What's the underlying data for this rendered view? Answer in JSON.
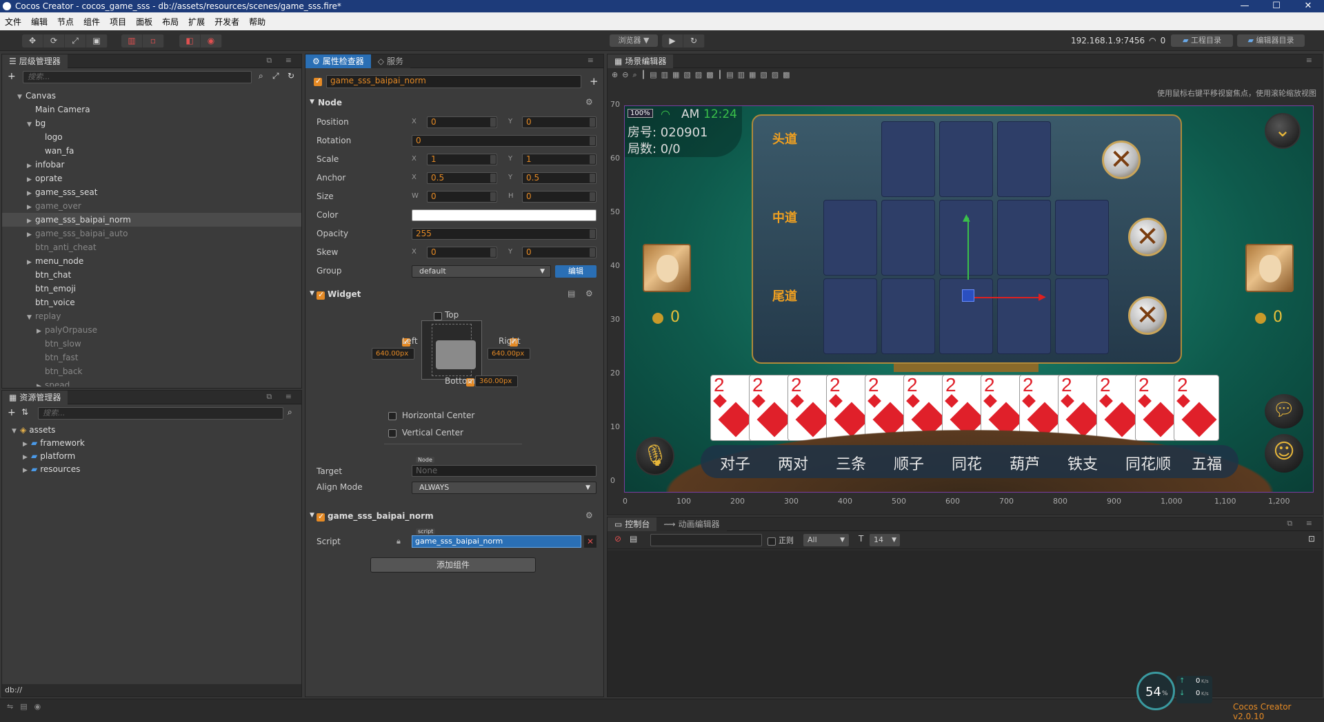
{
  "window": {
    "title": "Cocos Creator - cocos_game_sss - db://assets/resources/scenes/game_sss.fire*"
  },
  "menu": [
    "文件",
    "编辑",
    "节点",
    "组件",
    "项目",
    "面板",
    "布局",
    "扩展",
    "开发者",
    "帮助"
  ],
  "toolbar": {
    "preview_label": "浏览器 ▼",
    "ip": "192.168.1.9:7456",
    "conn_count": "0",
    "project_dir": "工程目录",
    "editor_dir": "编辑器目录"
  },
  "hierarchy": {
    "title": "层级管理器",
    "search_placeholder": "搜索...",
    "nodes": [
      {
        "label": "Canvas",
        "depth": 0,
        "arrow": "▼",
        "dim": false
      },
      {
        "label": "Main Camera",
        "depth": 1,
        "arrow": "",
        "dim": false
      },
      {
        "label": "bg",
        "depth": 1,
        "arrow": "▼",
        "dim": false
      },
      {
        "label": "logo",
        "depth": 2,
        "arrow": "",
        "dim": false
      },
      {
        "label": "wan_fa",
        "depth": 2,
        "arrow": "",
        "dim": false
      },
      {
        "label": "infobar",
        "depth": 1,
        "arrow": "▶",
        "dim": false
      },
      {
        "label": "oprate",
        "depth": 1,
        "arrow": "▶",
        "dim": false
      },
      {
        "label": "game_sss_seat",
        "depth": 1,
        "arrow": "▶",
        "dim": false
      },
      {
        "label": "game_over",
        "depth": 1,
        "arrow": "▶",
        "dim": true
      },
      {
        "label": "game_sss_baipai_norm",
        "depth": 1,
        "arrow": "▶",
        "dim": false,
        "selected": true
      },
      {
        "label": "game_sss_baipai_auto",
        "depth": 1,
        "arrow": "▶",
        "dim": true
      },
      {
        "label": "btn_anti_cheat",
        "depth": 1,
        "arrow": "",
        "dim": true
      },
      {
        "label": "menu_node",
        "depth": 1,
        "arrow": "▶",
        "dim": false
      },
      {
        "label": "btn_chat",
        "depth": 1,
        "arrow": "",
        "dim": false
      },
      {
        "label": "btn_emoji",
        "depth": 1,
        "arrow": "",
        "dim": false
      },
      {
        "label": "btn_voice",
        "depth": 1,
        "arrow": "",
        "dim": false
      },
      {
        "label": "replay",
        "depth": 1,
        "arrow": "▼",
        "dim": true
      },
      {
        "label": "palyOrpause",
        "depth": 2,
        "arrow": "▶",
        "dim": true
      },
      {
        "label": "btn_slow",
        "depth": 2,
        "arrow": "",
        "dim": true
      },
      {
        "label": "btn_fast",
        "depth": 2,
        "arrow": "",
        "dim": true
      },
      {
        "label": "btn_back",
        "depth": 2,
        "arrow": "",
        "dim": true
      },
      {
        "label": "spead",
        "depth": 2,
        "arrow": "▶",
        "dim": true
      }
    ]
  },
  "assets": {
    "title": "资源管理器",
    "search_placeholder": "搜索...",
    "items": [
      {
        "label": "assets",
        "depth": 0,
        "arrow": "▼"
      },
      {
        "label": "framework",
        "depth": 1,
        "arrow": "▶"
      },
      {
        "label": "platform",
        "depth": 1,
        "arrow": "▶"
      },
      {
        "label": "resources",
        "depth": 1,
        "arrow": "▶"
      }
    ],
    "status": "db://"
  },
  "inspector": {
    "tab_active": "属性检查器",
    "tab_inactive": "服务",
    "node_name": "game_sss_baipai_norm",
    "node_section": "Node",
    "props": {
      "position": {
        "label": "Position",
        "x": "0",
        "y": "0"
      },
      "rotation": {
        "label": "Rotation",
        "v": "0"
      },
      "scale": {
        "label": "Scale",
        "x": "1",
        "y": "1"
      },
      "anchor": {
        "label": "Anchor",
        "x": "0.5",
        "y": "0.5"
      },
      "size": {
        "label": "Size",
        "w": "0",
        "h": "0"
      },
      "color": {
        "label": "Color",
        "value": "#ffffff"
      },
      "opacity": {
        "label": "Opacity",
        "v": "255"
      },
      "skew": {
        "label": "Skew",
        "x": "0",
        "y": "0"
      },
      "group": {
        "label": "Group",
        "v": "default",
        "edit": "编辑"
      }
    },
    "axis": {
      "x": "X",
      "y": "Y",
      "w": "W",
      "h": "H"
    },
    "widget": {
      "title": "Widget",
      "top": "Top",
      "left": "Left",
      "right": "Right",
      "bottom": "Bottom",
      "left_val": "640.00px",
      "right_val": "640.00px",
      "bottom_val": "360.00px",
      "hcenter": "Horizontal Center",
      "vcenter": "Vertical Center",
      "target_label": "Target",
      "target_tag": "Node",
      "target_value": "None",
      "align_label": "Align Mode",
      "align_value": "ALWAYS"
    },
    "script_comp": {
      "title": "game_sss_baipai_norm",
      "script_label": "Script",
      "script_tag": "script",
      "script_value": "game_sss_baipai_norm"
    },
    "add_component": "添加组件"
  },
  "scene": {
    "title": "场景编辑器",
    "hint": "使用鼠标右键平移视窗焦点，使用滚轮缩放视图",
    "ruler_y": [
      "70",
      "60",
      "50",
      "40",
      "30",
      "20",
      "10",
      "0"
    ],
    "ruler_x": [
      "0",
      "100",
      "200",
      "300",
      "400",
      "500",
      "600",
      "700",
      "800",
      "900",
      "1,000",
      "1,100",
      "1,200"
    ],
    "game": {
      "zoom": "100%",
      "time_prefix": "AM",
      "time": "12:24",
      "room": "房号: 020901",
      "rounds": "局数: 0/0",
      "row_labels": [
        "头道",
        "中道",
        "尾道"
      ],
      "coin_left": "0",
      "coin_right": "0",
      "card_value": "2",
      "card_count": 13,
      "hand_types": [
        "对子",
        "两对",
        "三条",
        "顺子",
        "同花",
        "葫芦",
        "铁支",
        "同花顺",
        "五福"
      ]
    }
  },
  "console": {
    "tab_console": "控制台",
    "tab_anim": "动画编辑器",
    "regex_label": "正则",
    "level": "All",
    "font_size": "14"
  },
  "statusbar": {
    "version": "Cocos Creator v2.0.10",
    "cpu_percent": "54",
    "up_speed": "0",
    "down_speed": "0",
    "speed_unit": "K/s"
  }
}
